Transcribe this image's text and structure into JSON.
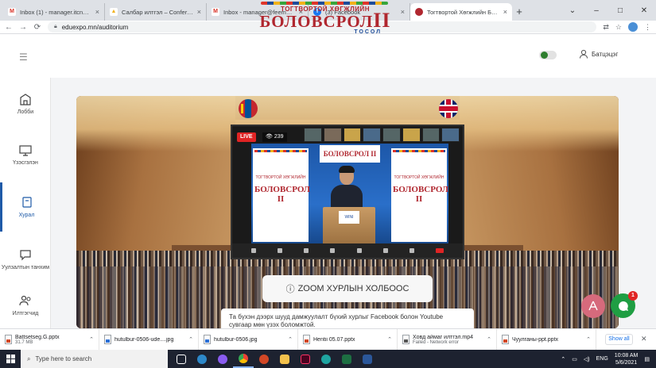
{
  "browser": {
    "tabs": [
      {
        "title": "Inbox (1) - manager.itcne@gmail.c",
        "icon": "gmail-icon",
        "color": "#d93025",
        "glyph": "M"
      },
      {
        "title": "Салбар илтгэл – Conference - Goo",
        "icon": "drive-icon",
        "color": "#f2b21b",
        "glyph": "▲"
      },
      {
        "title": "Inbox - manager@feemongolia.mn",
        "icon": "gmail-icon",
        "color": "#d93025",
        "glyph": "M"
      },
      {
        "title": "(3) Facebook",
        "icon": "facebook-icon",
        "color": "#1877f2",
        "glyph": "f"
      },
      {
        "title": "Тогтвортой Хөгжлийн Боловсрол",
        "icon": "site-icon",
        "color": "#b0272f",
        "glyph": "●"
      }
    ],
    "active_tab": 4,
    "url": "eduexpo.mn/auditorium"
  },
  "site": {
    "logo_top": "ТОГТВОРТОЙ ХӨГЖЛИЙН",
    "logo_main": "БОЛОВСРОЛ",
    "logo_roman": "II",
    "logo_bottom": "ТОСОЛ",
    "user_name": "Батцэцэг"
  },
  "sidebar": {
    "items": [
      {
        "label": "Лобби",
        "icon": "lobby-icon"
      },
      {
        "label": "Үзэсгэлэн",
        "icon": "exhibition-icon"
      },
      {
        "label": "Хурал",
        "icon": "conference-icon"
      },
      {
        "label": "Уулзалтын танхим",
        "icon": "meeting-room-icon"
      },
      {
        "label": "Илтгэгчид",
        "icon": "speakers-icon"
      }
    ],
    "active": "Хурал"
  },
  "stream": {
    "live_label": "LIVE",
    "viewer_count": "239",
    "top_banner": "БОЛОВСРОЛ II",
    "banner_text": "БОЛОВСРОЛ II",
    "banner_sub": "ТОГТВОРТОЙ ХӨГЖЛИЙН",
    "podium_label": "WINI"
  },
  "zoom_link_label": "ZOOM ХУРЛЫН ХОЛБООС",
  "notice_text": "Та бүхэн дээрх шууд дамжуулалт бүхий хурлыг Facebook болон Youtube сувгаар мөн үзэх боломжтой.",
  "chat_badge": "1",
  "downloads": [
    {
      "name": "Battsetseg.G.pptx",
      "sub": "31.7 MB",
      "type": "ppt"
    },
    {
      "name": "hutulbur-0506-ude....jpg",
      "sub": "",
      "type": "jpg"
    },
    {
      "name": "hutulbur-0506.jpg",
      "sub": "",
      "type": "jpg"
    },
    {
      "name": "Hentii 05.07.pptx",
      "sub": "",
      "type": "ppt"
    },
    {
      "name": "Ховд аймаг илтгэл.mp4",
      "sub": "Failed - Network error",
      "type": "mp4"
    },
    {
      "name": "Чуулганы-ppt.pptx",
      "sub": "",
      "type": "ppt"
    }
  ],
  "downloads_show_all": "Show all",
  "taskbar": {
    "search_placeholder": "Type here to search",
    "language": "ENG",
    "time": "10:08 AM",
    "date": "5/6/2021"
  }
}
